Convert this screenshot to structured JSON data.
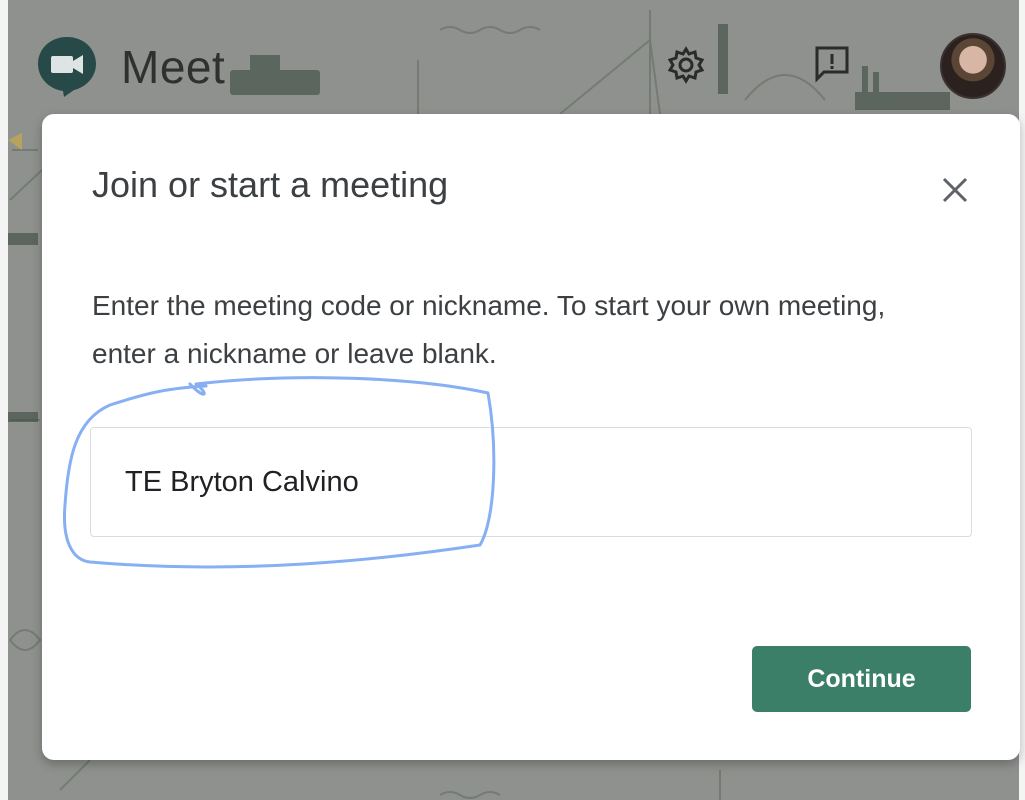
{
  "app": {
    "name": "Meet"
  },
  "header": {
    "settings_icon": "gear-icon",
    "feedback_icon": "feedback-icon",
    "avatar_icon": "account-avatar"
  },
  "dialog": {
    "title": "Join or start a meeting",
    "close_icon": "close-icon",
    "description": "Enter the meeting code or nickname. To start your own meeting, enter a nickname or leave blank.",
    "input": {
      "value": "TE Bryton Calvino",
      "placeholder": ""
    },
    "continue_label": "Continue"
  },
  "colors": {
    "accent": "#3b7f68",
    "overlay": "#8e918d",
    "annotation": "#7aa6f2",
    "title_text": "#3c4043"
  }
}
